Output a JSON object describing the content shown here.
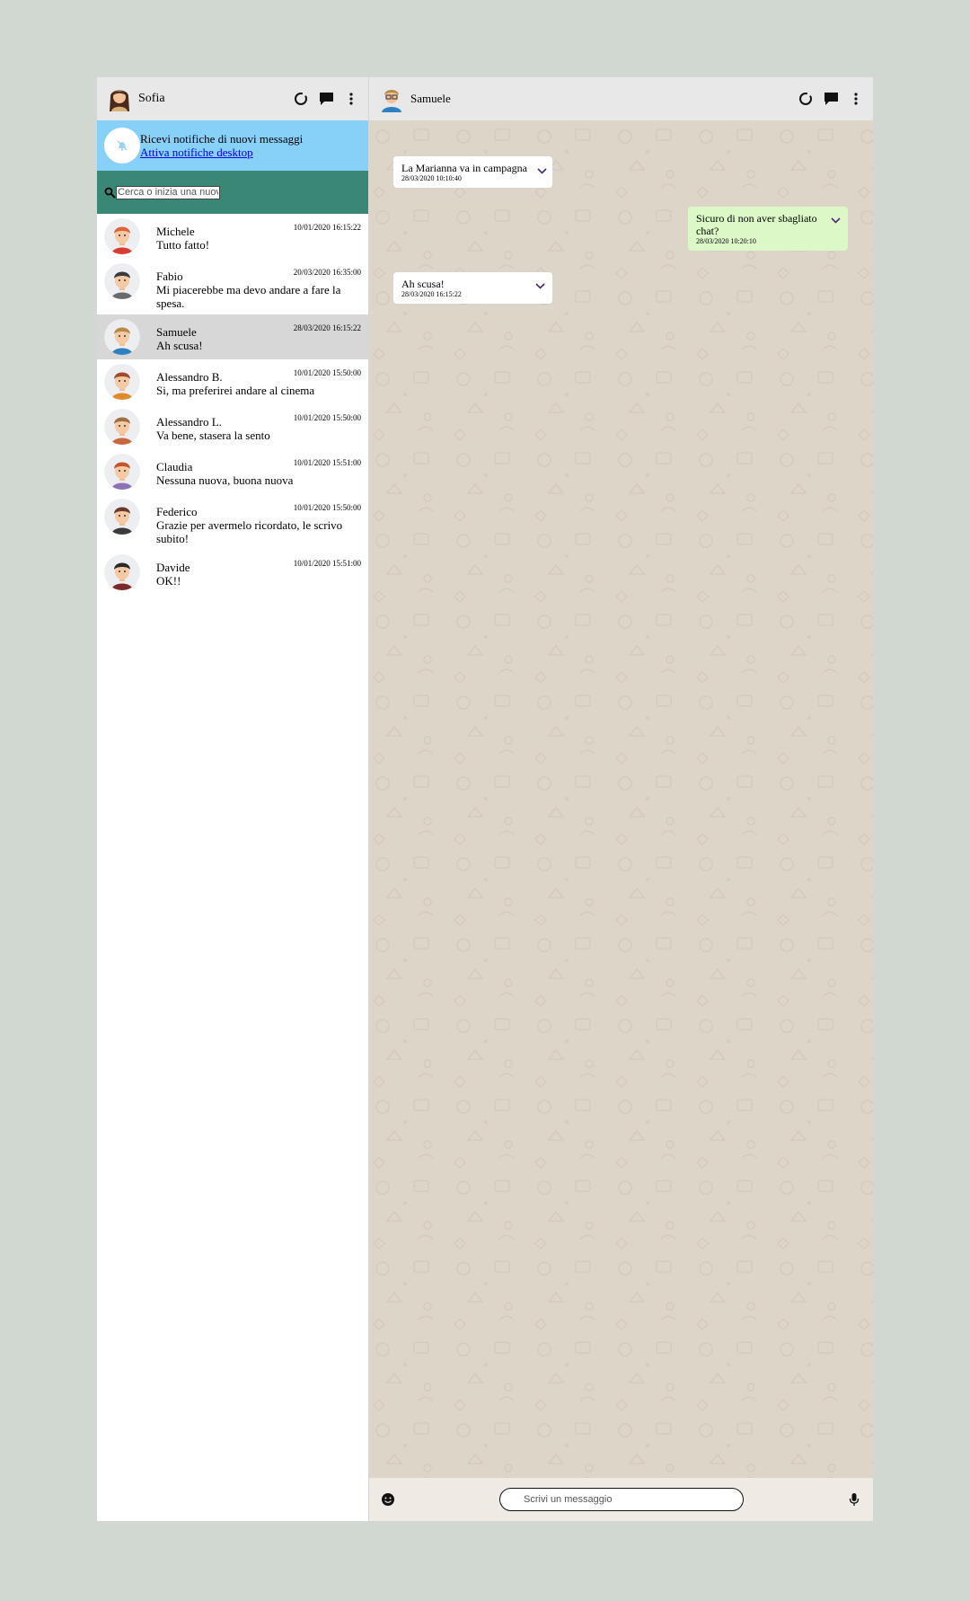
{
  "sidebar": {
    "user_name": "Sofia",
    "notification": {
      "title": "Ricevi notifiche di nuovi messaggi",
      "link": "Attiva notifiche desktop"
    },
    "search": {
      "placeholder": "Cerca o inizia una nuova chat",
      "value": ""
    },
    "chats": [
      {
        "name": "Michele",
        "last": "Tutto fatto!",
        "time": "10/01/2020 16:15:22",
        "hair": "#e0623b",
        "shirt": "#d83b32",
        "active": false
      },
      {
        "name": "Fabio",
        "last": "Mi piacerebbe ma devo andare a fare la spesa.",
        "time": "20/03/2020 16:35:00",
        "hair": "#3b3b3b",
        "shirt": "#6a6a6a",
        "active": false
      },
      {
        "name": "Samuele",
        "last": "Ah scusa!",
        "time": "28/03/2020 16:15:22",
        "hair": "#b88a4a",
        "shirt": "#2f7fc1",
        "active": true
      },
      {
        "name": "Alessandro B.",
        "last": "Si, ma preferirei andare al cinema",
        "time": "10/01/2020 15:50:00",
        "hair": "#a44a2a",
        "shirt": "#e08a2b",
        "active": false
      },
      {
        "name": "Alessandro L.",
        "last": "Va bene, stasera la sento",
        "time": "10/01/2020 15:50:00",
        "hair": "#9e7040",
        "shirt": "#c9683f",
        "active": false
      },
      {
        "name": "Claudia",
        "last": "Nessuna nuova, buona nuova",
        "time": "10/01/2020 15:51:00",
        "hair": "#c4522a",
        "shirt": "#8e72b8",
        "active": false
      },
      {
        "name": "Federico",
        "last": "Grazie per avermelo ricordato, le scrivo subito!",
        "time": "10/01/2020 15:50:00",
        "hair": "#6b3a2a",
        "shirt": "#3a3a3a",
        "active": false
      },
      {
        "name": "Davide",
        "last": "OK!!",
        "time": "10/01/2020 15:51:00",
        "hair": "#2a2a2a",
        "shirt": "#7a2a2a",
        "active": false
      }
    ]
  },
  "conversation": {
    "contact_name": "Samuele",
    "messages": [
      {
        "direction": "in",
        "text": "La Marianna va in campagna",
        "time": "28/03/2020 10:10:40"
      },
      {
        "direction": "out",
        "text": "Sicuro di non aver sbagliato chat?",
        "time": "28/03/2020 10:20:10"
      },
      {
        "direction": "in",
        "text": "Ah scusa!",
        "time": "28/03/2020 16:15:22"
      }
    ],
    "composer": {
      "placeholder": "Scrivi un messaggio",
      "value": ""
    }
  },
  "colors": {
    "notification_bar": "#87d1f9",
    "search_bar": "#3a8776",
    "outgoing_bubble": "#dcf8c6",
    "incoming_bubble": "#ffffff",
    "active_chat": "#d7d7d7",
    "chevron": "#4b2a7a"
  }
}
